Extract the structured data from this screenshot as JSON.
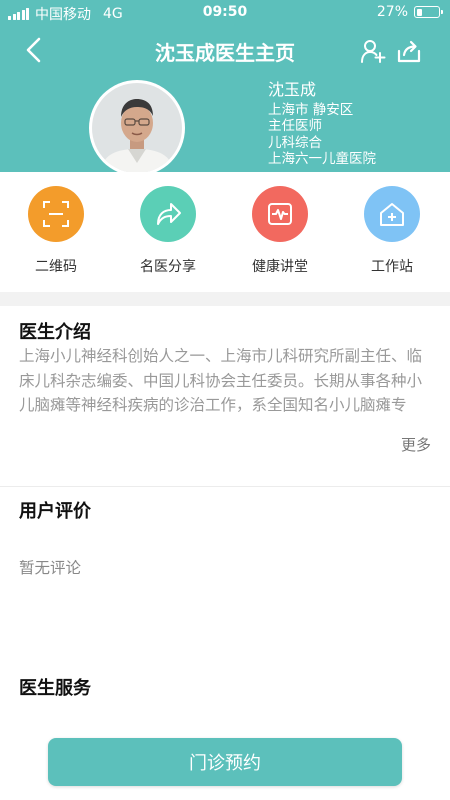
{
  "status": {
    "carrier": "中国移动",
    "network": "4G",
    "time": "09:50",
    "battery": "27%",
    "battery_level": 0.27
  },
  "nav": {
    "title": "沈玉成医生主页"
  },
  "doctor": {
    "name": "沈玉成",
    "location": "上海市 静安区",
    "title": "主任医师",
    "department": "儿科综合",
    "hospital": "上海六一儿童医院"
  },
  "actions": [
    {
      "label": "二维码",
      "icon": "qrcode-scan-icon",
      "color": "#f39c2b"
    },
    {
      "label": "名医分享",
      "icon": "share-arrow-icon",
      "color": "#5bcfb6"
    },
    {
      "label": "健康讲堂",
      "icon": "health-pulse-icon",
      "color": "#f2695f"
    },
    {
      "label": "工作站",
      "icon": "workstation-house-icon",
      "color": "#7fc3f5"
    }
  ],
  "intro": {
    "title": "医生介绍",
    "text": "上海小儿神经科创始人之一、上海市儿科研究所副主任、临床儿科杂志编委、中国儿科协会主任委员。长期从事各种小儿脑瘫等神经科疾病的诊治工作，系全国知名小儿脑瘫专家。多次应邀出访欧、美、日等国家，…",
    "more": "更多"
  },
  "reviews": {
    "title": "用户评价",
    "empty": "暂无评论"
  },
  "services": {
    "title": "医生服务"
  },
  "book_button": "门诊预约",
  "colors": {
    "primary": "#5cc0bb"
  }
}
